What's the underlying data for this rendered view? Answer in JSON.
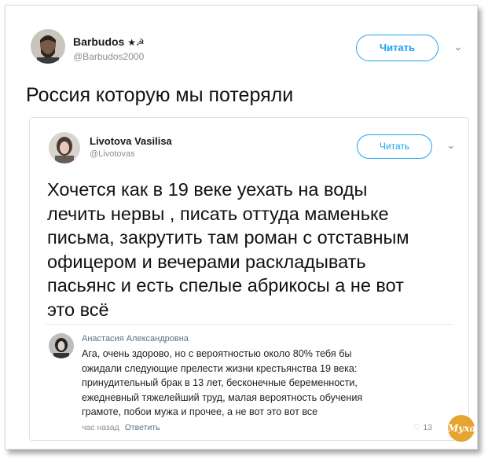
{
  "outer_tweet": {
    "author_name": "Barbudos",
    "author_badge": "★☭",
    "author_handle": "@Barbudos2000",
    "follow_label": "Читать",
    "text": "Россия которую мы потеряли"
  },
  "quoted_tweet": {
    "author_name": "Livotova Vasilisa",
    "author_handle": "@Livotovas",
    "follow_label": "Читать",
    "text_lines": [
      "Хочется как в 19 веке уехать на воды",
      "лечить нервы , писать оттуда маменьке",
      "письма, закрутить там роман с отставным",
      "офицером и вечерами раскладывать",
      "пасьянс и есть спелые абрикосы а не вот",
      "это всё"
    ]
  },
  "reply": {
    "author_name": "Анастасия Александровна",
    "text_lines": [
      "Ага, очень здорово, но с вероятностью около 80% тебя бы",
      "ожидали следующие прелести жизни крестьянства 19 века:",
      "принудительный брак в 13 лет, бесконечные беременности,",
      "ежедневный тяжелейший труд, малая вероятность обучения",
      "грамоте, побои мужа и прочее, а не вот это вот все"
    ],
    "time": "час назад",
    "reply_label": "Ответить",
    "likes": "13"
  },
  "watermark": "Муха",
  "colors": {
    "accent": "#1da1f2",
    "watermark_bg": "#e6a430"
  }
}
